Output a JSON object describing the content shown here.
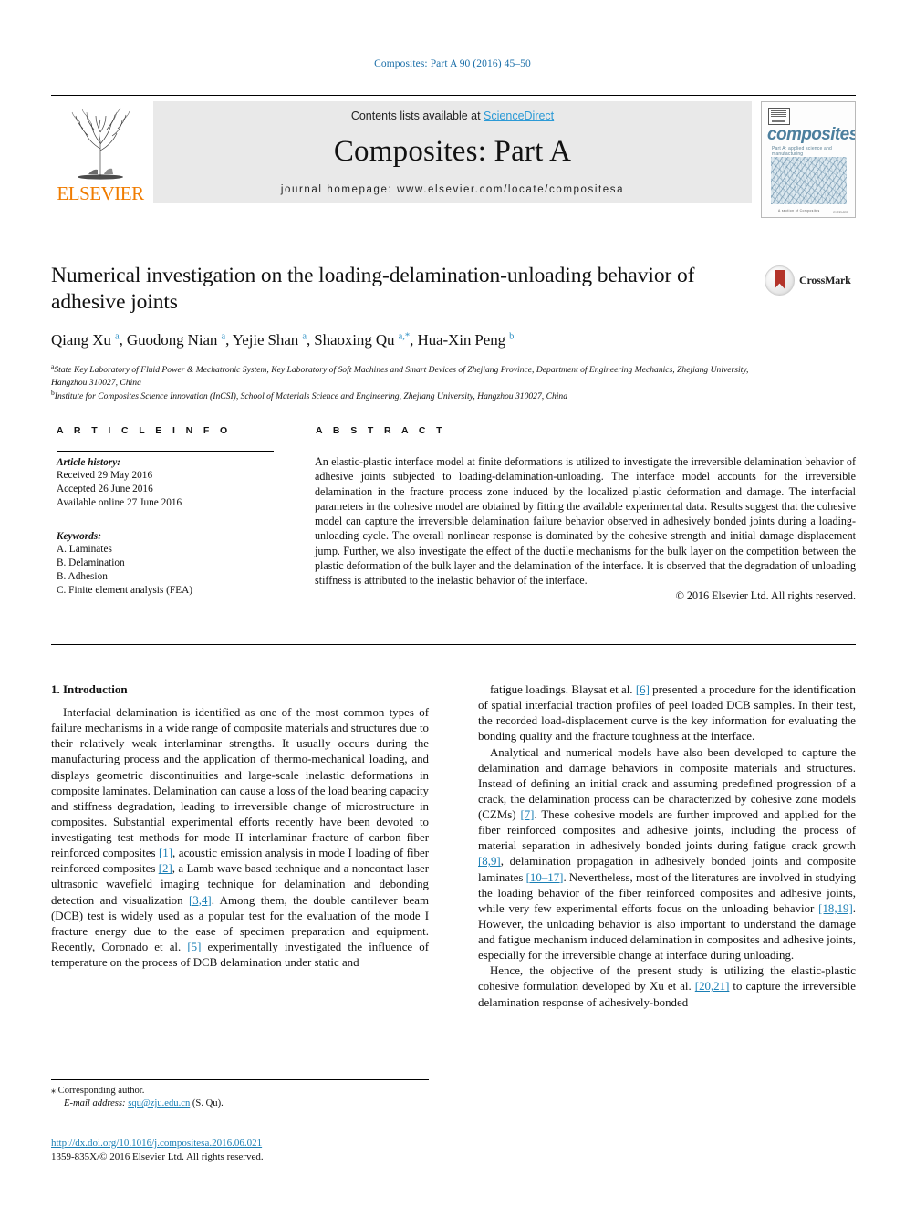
{
  "running_head": "Composites: Part A 90 (2016) 45–50",
  "header": {
    "contents_prefix": "Contents lists available at ",
    "sciencedirect": "ScienceDirect",
    "journal_title": "Composites: Part A",
    "homepage": "journal homepage: www.elsevier.com/locate/compositesa",
    "publisher_logo_text": "ELSEVIER",
    "cover": {
      "word": "composites",
      "subtitle": "Part A: applied science and manufacturing",
      "footer_left": "A section of Composites",
      "footer_right": "ELSEVIER"
    }
  },
  "crossmark": {
    "label": "CrossMark"
  },
  "title": "Numerical investigation on the loading-delamination-unloading behavior of adhesive joints",
  "authors": [
    {
      "name": "Qiang Xu",
      "marks": "a"
    },
    {
      "name": "Guodong Nian",
      "marks": "a"
    },
    {
      "name": "Yejie Shan",
      "marks": "a"
    },
    {
      "name": "Shaoxing Qu",
      "marks": "a,*"
    },
    {
      "name": "Hua-Xin Peng",
      "marks": "b"
    }
  ],
  "affiliations": [
    {
      "mark": "a",
      "text": "State Key Laboratory of Fluid Power & Mechatronic System, Key Laboratory of Soft Machines and Smart Devices of Zhejiang Province, Department of Engineering Mechanics, Zhejiang University, Hangzhou 310027, China"
    },
    {
      "mark": "b",
      "text": "Institute for Composites Science Innovation (InCSI), School of Materials Science and Engineering, Zhejiang University, Hangzhou 310027, China"
    }
  ],
  "section_headings": {
    "article_info": "A R T I C L E   I N F O",
    "abstract": "A B S T R A C T"
  },
  "article_info": {
    "history_title": "Article history:",
    "history": [
      "Received 29 May 2016",
      "Accepted 26 June 2016",
      "Available online 27 June 2016"
    ],
    "keywords_title": "Keywords:",
    "keywords": [
      "A. Laminates",
      "B. Delamination",
      "B. Adhesion",
      "C. Finite element analysis (FEA)"
    ]
  },
  "abstract": {
    "text": "An elastic-plastic interface model at finite deformations is utilized to investigate the irreversible delamination behavior of adhesive joints subjected to loading-delamination-unloading. The interface model accounts for the irreversible delamination in the fracture process zone induced by the localized plastic deformation and damage. The interfacial parameters in the cohesive model are obtained by fitting the available experimental data. Results suggest that the cohesive model can capture the irreversible delamination failure behavior observed in adhesively bonded joints during a loading-unloading cycle. The overall nonlinear response is dominated by the cohesive strength and initial damage displacement jump. Further, we also investigate the effect of the ductile mechanisms for the bulk layer on the competition between the plastic deformation of the bulk layer and the delamination of the interface. It is observed that the degradation of unloading stiffness is attributed to the inelastic behavior of the interface.",
    "copyright": "© 2016 Elsevier Ltd. All rights reserved."
  },
  "body": {
    "section_number_title": "1. Introduction",
    "left_paragraphs": [
      "Interfacial delamination is identified as one of the most common types of failure mechanisms in a wide range of composite materials and structures due to their relatively weak interlaminar strengths. It usually occurs during the manufacturing process and the application of thermo-mechanical loading, and displays geometric discontinuities and large-scale inelastic deformations in composite laminates. Delamination can cause a loss of the load bearing capacity and stiffness degradation, leading to irreversible change of microstructure in composites. Substantial experimental efforts recently have been devoted to investigating test methods for mode II interlaminar fracture of carbon fiber reinforced composites [1], acoustic emission analysis in mode I loading of fiber reinforced composites [2], a Lamb wave based technique and a noncontact laser ultrasonic wavefield imaging technique for delamination and debonding detection and visualization [3,4]. Among them, the double cantilever beam (DCB) test is widely used as a popular test for the evaluation of the mode I fracture energy due to the ease of specimen preparation and equipment. Recently, Coronado et al. [5] experimentally investigated the influence of temperature on the process of DCB delamination under static and"
    ],
    "right_paragraphs": [
      "fatigue loadings. Blaysat et al. [6] presented a procedure for the identification of spatial interfacial traction profiles of peel loaded DCB samples. In their test, the recorded load-displacement curve is the key information for evaluating the bonding quality and the fracture toughness at the interface.",
      "Analytical and numerical models have also been developed to capture the delamination and damage behaviors in composite materials and structures. Instead of defining an initial crack and assuming predefined progression of a crack, the delamination process can be characterized by cohesive zone models (CZMs) [7]. These cohesive models are further improved and applied for the fiber reinforced composites and adhesive joints, including the process of material separation in adhesively bonded joints during fatigue crack growth [8,9], delamination propagation in adhesively bonded joints and composite laminates [10–17]. Nevertheless, most of the literatures are involved in studying the loading behavior of the fiber reinforced composites and adhesive joints, while very few experimental efforts focus on the unloading behavior [18,19]. However, the unloading behavior is also important to understand the damage and fatigue mechanism induced delamination in composites and adhesive joints, especially for the irreversible change at interface during unloading.",
      "Hence, the objective of the present study is utilizing the elastic-plastic cohesive formulation developed by Xu et al. [20,21] to capture the irreversible delamination response of adhesively-bonded"
    ]
  },
  "footnote": {
    "corresponding": "Corresponding author.",
    "email_label": "E-mail address:",
    "email": "squ@zju.edu.cn",
    "email_owner": "(S. Qu)."
  },
  "footer": {
    "doi": "http://dx.doi.org/10.1016/j.compositesa.2016.06.021",
    "issn": "1359-835X/© 2016 Elsevier Ltd. All rights reserved."
  },
  "colors": {
    "link_blue": "#1a7fb5",
    "sciencedirect_blue": "#2b9ad6",
    "elsevier_orange": "#F07C00",
    "crossmark_red": "#b3342a"
  }
}
